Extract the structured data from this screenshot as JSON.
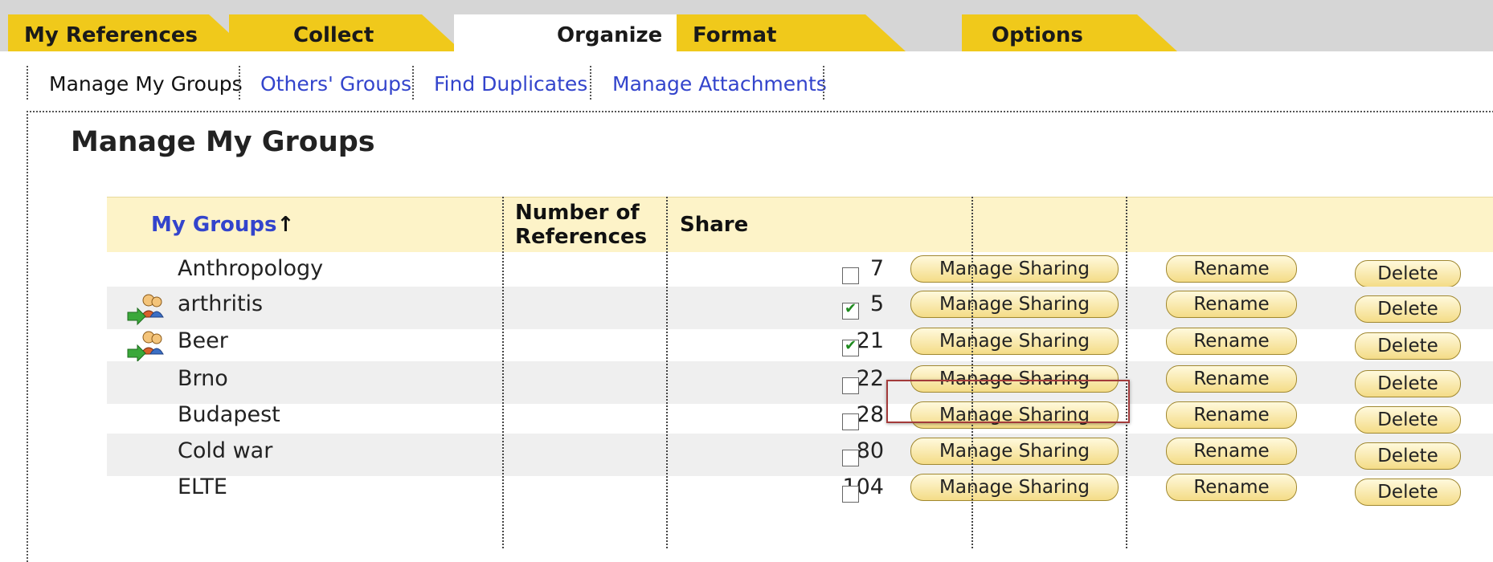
{
  "tabs": [
    {
      "label": "My References",
      "active": false
    },
    {
      "label": "Collect",
      "active": false
    },
    {
      "label": "Organize",
      "active": true
    },
    {
      "label": "Format",
      "active": false
    },
    {
      "label": "Options",
      "active": false
    }
  ],
  "subnav": [
    {
      "label": "Manage My Groups",
      "current": true
    },
    {
      "label": "Others' Groups",
      "current": false
    },
    {
      "label": "Find Duplicates",
      "current": false
    },
    {
      "label": "Manage Attachments",
      "current": false
    }
  ],
  "page_title": "Manage My Groups",
  "table": {
    "headers": {
      "groups": "My Groups",
      "sort_indicator": "↑",
      "count_line1": "Number of",
      "count_line2": "References",
      "share": "Share"
    },
    "button_labels": {
      "share": "Manage Sharing",
      "rename": "Rename",
      "delete": "Delete"
    },
    "rows": [
      {
        "name": "Anthropology",
        "count": "7",
        "shared": false
      },
      {
        "name": "arthritis",
        "count": "5",
        "shared": true
      },
      {
        "name": "Beer",
        "count": "21",
        "shared": true
      },
      {
        "name": "Brno",
        "count": "22",
        "shared": false
      },
      {
        "name": "Budapest",
        "count": "28",
        "shared": false
      },
      {
        "name": "Cold war",
        "count": "80",
        "shared": false
      },
      {
        "name": "ELTE",
        "count": "104",
        "shared": false
      }
    ]
  },
  "colors": {
    "tab_yellow": "#f0c91b",
    "tab_bar_gray": "#d6d6d6",
    "link_blue": "#3344cc",
    "header_bg": "#fdf3c8",
    "alt_row_bg": "#efefef",
    "highlight_border": "#a33a3a"
  },
  "icons": {
    "shared_group": "shared-group-icon"
  }
}
